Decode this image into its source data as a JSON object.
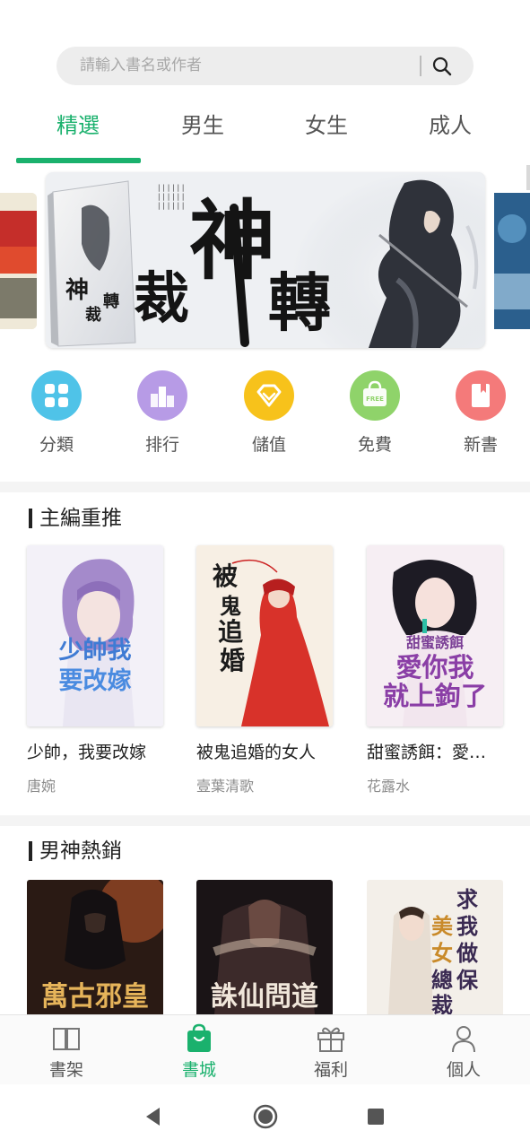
{
  "search": {
    "placeholder": "請輸入書名或作者"
  },
  "tabs": [
    {
      "label": "精選",
      "active": true
    },
    {
      "label": "男生",
      "active": false
    },
    {
      "label": "女生",
      "active": false
    },
    {
      "label": "成人",
      "active": false
    }
  ],
  "banner": {
    "title_large": "神裁轉",
    "title_small": "神裁轉"
  },
  "quick_nav": [
    {
      "label": "分類",
      "icon": "grid-icon",
      "color": "#4fc3e8"
    },
    {
      "label": "排行",
      "icon": "ranking-icon",
      "color": "#b79be6"
    },
    {
      "label": "儲值",
      "icon": "diamond-icon",
      "color": "#f7c21b"
    },
    {
      "label": "免費",
      "icon": "free-bag-icon",
      "color": "#8fd36a",
      "badge": "FREE"
    },
    {
      "label": "新書",
      "icon": "bookmark-icon",
      "color": "#f47a7a"
    }
  ],
  "sections": {
    "editor_picks": {
      "title": "主編重推",
      "books": [
        {
          "title": "少帥，我要改嫁",
          "author": "唐婉",
          "cover_text": "少帥我要改嫁"
        },
        {
          "title": "被鬼追婚的女人",
          "author": "壹葉清歌",
          "cover_text": "被鬼追婚"
        },
        {
          "title": "甜蜜誘餌：愛妳我就上鉤了",
          "author": "花露水",
          "cover_text_small": "甜蜜誘餌",
          "cover_text": "愛你我就上鉤了"
        }
      ]
    },
    "male_bestsellers": {
      "title": "男神熱銷",
      "books": [
        {
          "cover_text": "萬古邪皇"
        },
        {
          "cover_text": "誅仙問道"
        },
        {
          "cover_text": "求我做保美女總裁"
        }
      ]
    }
  },
  "bottom_nav": [
    {
      "label": "書架",
      "icon": "book-open-icon",
      "active": false
    },
    {
      "label": "書城",
      "icon": "shopping-bag-icon",
      "active": true
    },
    {
      "label": "福利",
      "icon": "gift-icon",
      "active": false
    },
    {
      "label": "個人",
      "icon": "person-icon",
      "active": false
    }
  ],
  "system_nav": [
    "back-icon",
    "home-icon",
    "recents-icon"
  ],
  "colors": {
    "accent": "#1ab16d",
    "text": "#222222",
    "muted": "#8c8c8c"
  }
}
